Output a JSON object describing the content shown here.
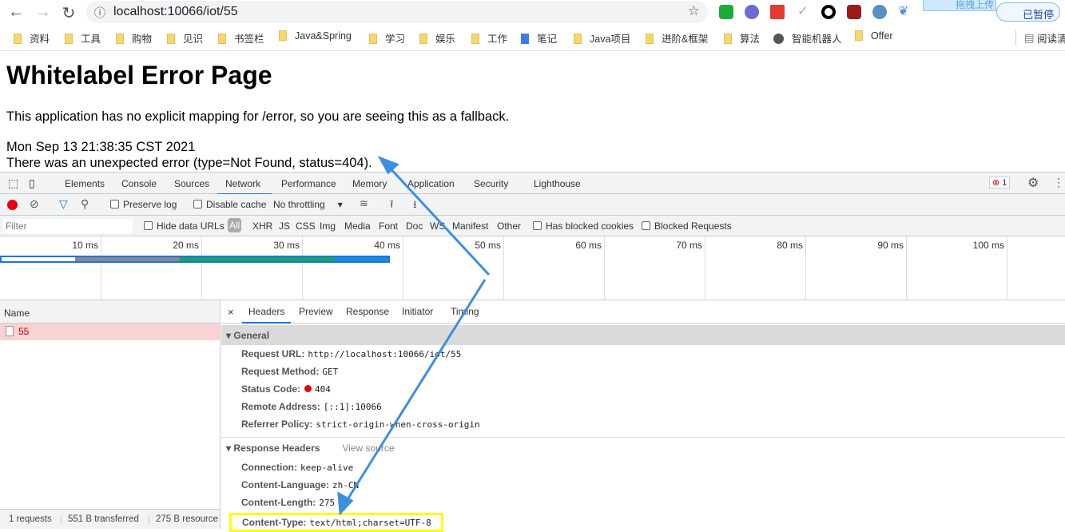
{
  "browser": {
    "url": "localhost:10066/iot/55",
    "profile_label": "已暂停",
    "upload_tooltip": "拖拽上传",
    "bookmarks": [
      "资料",
      "工具",
      "购物",
      "见识",
      "书签栏",
      "Java&Spring",
      "学习",
      "娱乐",
      "工作",
      "笔记",
      "Java项目",
      "进阶&框架",
      "算法",
      "智能机器人",
      "Offer"
    ],
    "reading_list": "阅读清"
  },
  "page": {
    "title": "Whitelabel Error Page",
    "message": "This application has no explicit mapping for /error, so you are seeing this as a fallback.",
    "timestamp": "Mon Sep 13 21:38:35 CST 2021",
    "error": "There was an unexpected error (type=Not Found, status=404)."
  },
  "devtools": {
    "tabs": [
      "Elements",
      "Console",
      "Sources",
      "Network",
      "Performance",
      "Memory",
      "Application",
      "Security",
      "Lighthouse"
    ],
    "active_tab": "Network",
    "error_count": "1",
    "toolbar": {
      "preserve_log": "Preserve log",
      "disable_cache": "Disable cache",
      "throttling": "No throttling"
    },
    "filter": {
      "placeholder": "Filter",
      "hide_data_urls": "Hide data URLs",
      "types": [
        "All",
        "XHR",
        "JS",
        "CSS",
        "Img",
        "Media",
        "Font",
        "Doc",
        "WS",
        "Manifest",
        "Other"
      ],
      "has_blocked_cookies": "Has blocked cookies",
      "blocked_requests": "Blocked Requests"
    },
    "timeline": {
      "ticks": [
        "10 ms",
        "20 ms",
        "30 ms",
        "40 ms",
        "50 ms",
        "60 ms",
        "70 ms",
        "80 ms",
        "90 ms",
        "100 ms"
      ]
    },
    "list": {
      "header": "Name",
      "requests": [
        {
          "name": "55",
          "status": "error"
        }
      ],
      "status": [
        "1 requests",
        "551 B transferred",
        "275 B resource"
      ]
    },
    "detail": {
      "tabs": [
        "Headers",
        "Preview",
        "Response",
        "Initiator",
        "Timing"
      ],
      "active_tab": "Headers",
      "general": {
        "title": "General",
        "rows": [
          {
            "k": "Request URL:",
            "v": "http://localhost:10066/iot/55"
          },
          {
            "k": "Request Method:",
            "v": "GET"
          },
          {
            "k": "Status Code:",
            "v": "404"
          },
          {
            "k": "Remote Address:",
            "v": "[::1]:10066"
          },
          {
            "k": "Referrer Policy:",
            "v": "strict-origin-when-cross-origin"
          }
        ]
      },
      "response": {
        "title": "Response Headers",
        "view_source": "View source",
        "rows": [
          {
            "k": "Connection:",
            "v": "keep-alive"
          },
          {
            "k": "Content-Language:",
            "v": "zh-CN"
          },
          {
            "k": "Content-Length:",
            "v": "275"
          },
          {
            "k": "Content-Type:",
            "v": "text/html;charset=UTF-8"
          }
        ]
      }
    }
  },
  "colors": {
    "accent": "#1a73e8",
    "error": "#e8000d",
    "annotation_arrow": "#3d8fe0",
    "highlight_box": "#ffff00"
  }
}
